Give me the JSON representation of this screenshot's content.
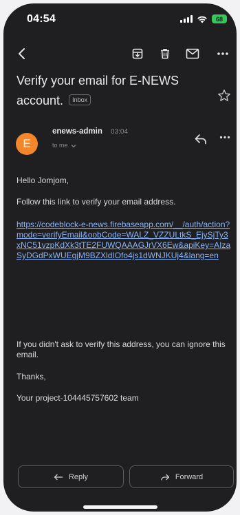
{
  "status_bar": {
    "time": "04:54",
    "battery": "68"
  },
  "toolbar": {
    "icons": [
      "back-icon",
      "archive-icon",
      "delete-icon",
      "mail-icon",
      "more-icon"
    ]
  },
  "email": {
    "subject": "Verify your email for E-NEWS account.",
    "label": "Inbox",
    "sender": {
      "initial": "E",
      "name": "enews-admin",
      "time": "03:04",
      "to": "to me"
    },
    "body": {
      "greeting": "Hello Jomjom,",
      "intro": "Follow this link to verify your email address.",
      "link": "https://codeblock-e-news.firebaseapp.com/__/auth/action?mode=verifyEmail&oobCode=WALZ_VZZULtkS_EjySjTy3xNC51vzpKdXk3tTE2FUWQAAAGJrVX6Ew&apiKey=AIzaSyDGdPxWUEgjM9BZXldIOfo4js1dWNJKUj4&lang=en",
      "ignore_note": "If you didn't ask to verify this address, you can ignore this email.",
      "thanks": "Thanks,",
      "signature": "Your project-104445757602 team"
    }
  },
  "actions": {
    "reply": "Reply",
    "forward": "Forward"
  },
  "colors": {
    "background": "#1f1f21",
    "avatar": "#f2862a",
    "link": "#8ab4f8",
    "battery": "#34c759"
  }
}
